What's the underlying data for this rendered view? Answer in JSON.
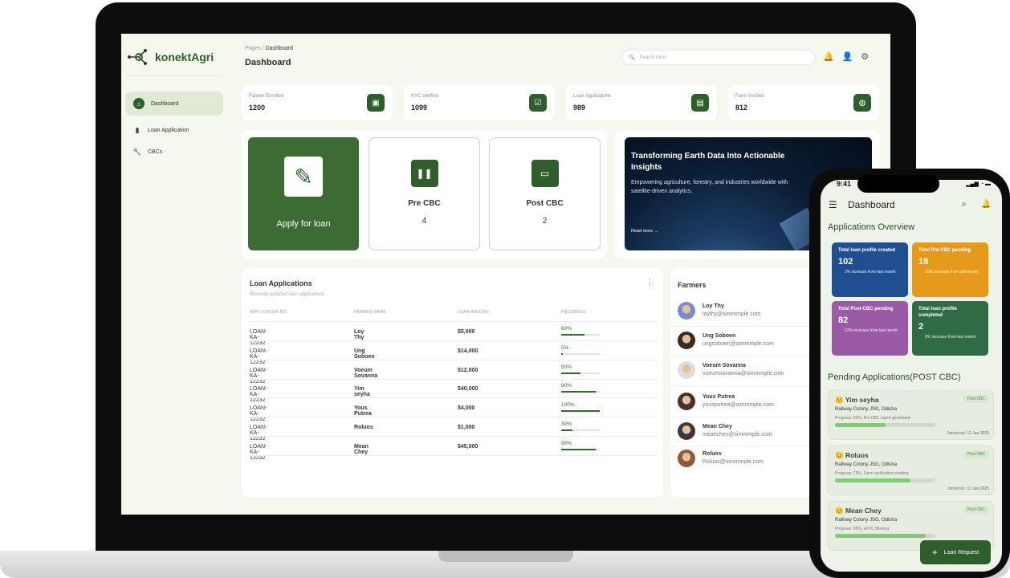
{
  "app": {
    "name": "konektAgri"
  },
  "sidebar": {
    "items": [
      {
        "label": "Dashboard",
        "icon": "home-icon",
        "active": true
      },
      {
        "label": "Loan Application",
        "icon": "document-icon"
      },
      {
        "label": "CBCs",
        "icon": "wrench-icon"
      }
    ]
  },
  "header": {
    "breadcrumb_root": "Pages",
    "breadcrumb_current": "Dashboard",
    "title": "Dashboard",
    "search_placeholder": "Search here"
  },
  "stats": [
    {
      "label": "Farmer Enrolled",
      "value": "1200",
      "icon": "id-card-icon"
    },
    {
      "label": "KYC Verified",
      "value": "1099",
      "icon": "check-icon"
    },
    {
      "label": "Loan Applications",
      "value": "989",
      "icon": "file-icon"
    },
    {
      "label": "Farm Verified",
      "value": "812",
      "icon": "globe-icon"
    }
  ],
  "actions": {
    "apply": "Apply for loan",
    "pre_cbc": {
      "label": "Pre CBC",
      "count": "4"
    },
    "post_cbc": {
      "label": "Post CBC",
      "count": "2"
    }
  },
  "banner": {
    "title": "Transforming Earth Data Into Actionable Insights",
    "subtitle": "Empowering agriculture, forestry, and industries worldwide with satellite-driven analytics.",
    "link": "Read more →"
  },
  "loans": {
    "title": "Loan Applications",
    "subtitle": "Recently updated loan applications",
    "headers": [
      "APPLICATION NO.",
      "FARMER NAME",
      "LOAN AMOUNT",
      "PROGRESS"
    ],
    "rows": [
      {
        "id": "LOAN-KA-12232",
        "name": "Loy Thy",
        "amount": "$5,000",
        "progress": "60%",
        "pct": 0.6
      },
      {
        "id": "LOAN-KA-12232",
        "name": "Ung Soboen",
        "amount": "$14,000",
        "progress": "5%",
        "pct": 0.05
      },
      {
        "id": "LOAN-KA-12232",
        "name": "Voeum Sovanna",
        "amount": "$12,000",
        "progress": "50%",
        "pct": 0.5
      },
      {
        "id": "LOAN-KA-12232",
        "name": "Yim seyha",
        "amount": "$40,000",
        "progress": "90%",
        "pct": 0.9
      },
      {
        "id": "LOAN-KA-12232",
        "name": "Yous Putrea",
        "amount": "$4,000",
        "progress": "100%",
        "pct": 1.0
      },
      {
        "id": "LOAN-KA-12232",
        "name": "Roluos",
        "amount": "$1,000",
        "progress": "30%",
        "pct": 0.3
      },
      {
        "id": "LOAN-KA-12232",
        "name": "Mean Chey",
        "amount": "$45,000",
        "progress": "90%",
        "pct": 0.9
      }
    ]
  },
  "farmers": {
    "title": "Farmers",
    "list": [
      {
        "name": "Loy Thy",
        "email": "loythy@simmmple.com"
      },
      {
        "name": "Ung Soboen",
        "email": "ungsoboen@simmmple.com"
      },
      {
        "name": "Voeum Sovanna",
        "email": "voeumsovanna@simmmple.com"
      },
      {
        "name": "Yous Putrea",
        "email": "yousputrea@simmmple.com"
      },
      {
        "name": "Mean Chey",
        "email": "meanchey@simmmple.com"
      },
      {
        "name": "Roluos",
        "email": "Roluos@simmmple.com"
      }
    ]
  },
  "phone": {
    "time": "9:41",
    "title": "Dashboard",
    "overview_title": "Applications Overview",
    "tiles": [
      {
        "title": "Total loan profile created",
        "value": "102",
        "desc": "2% increase from last month",
        "color": "#1f4f8f"
      },
      {
        "title": "Total Pre-CBC pending",
        "value": "18",
        "desc": "10% increase from last month",
        "color": "#e69a1c"
      },
      {
        "title": "Total Post-CBC pending",
        "value": "82",
        "desc": "12% increase from last month",
        "color": "#9a5aa6"
      },
      {
        "title": "Total loan profile completed",
        "value": "2",
        "desc": "8% increase from last month",
        "color": "#2f6b45"
      }
    ],
    "pending_title": "Pending Applications(POST CBC)",
    "pending": [
      {
        "name": "Yim seyha",
        "address": "Railway Colony JSG, Odisha",
        "progress_text": "Progress: 50%, Pre CBC report generated",
        "pct": 0.5,
        "joined": "Joined on: 12 Jan 2025",
        "tag": "Post CBC"
      },
      {
        "name": "Roluos",
        "address": "Railway Colony JSG, Odisha",
        "progress_text": "Progress: 75%, Farm verification pending",
        "pct": 0.75,
        "joined": "Joined on: 12 Jan 2025",
        "tag": "Post CBC"
      },
      {
        "name": "Mean Chey",
        "address": "Railway Colony JSG, Odisha",
        "progress_text": "Progress: 90%, eKYC Missing",
        "pct": 0.9,
        "joined": "",
        "tag": "Post CBC"
      }
    ],
    "fab": "Loan Request"
  },
  "colors": {
    "primary": "#2f5e2b",
    "background": "#f4f8ee"
  }
}
